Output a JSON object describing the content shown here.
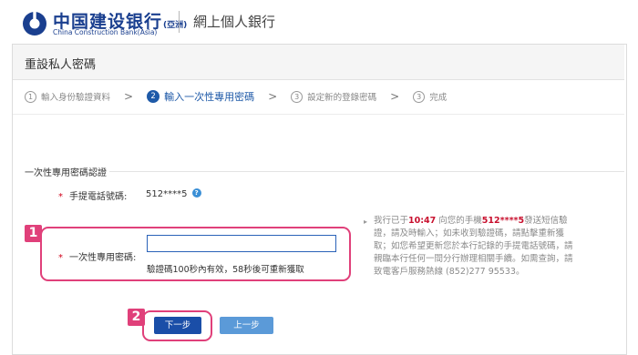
{
  "header": {
    "brand_cn": "中国建设银行",
    "brand_suffix": "(亞洲)",
    "brand_en": "China Construction Bank(Asia)",
    "title": "網上個人銀行",
    "logo_icon": "ccb-logo-icon",
    "brand_color": "#1a3f8f"
  },
  "page": {
    "title": "重設私人密碼"
  },
  "steps": [
    {
      "num": "①",
      "label": "輸入身份驗證資料",
      "active": false
    },
    {
      "num": "2",
      "label": "輸入一次性專用密碼",
      "active": true
    },
    {
      "num": "③",
      "label": "設定新的登錄密碼",
      "active": false
    },
    {
      "num": "③",
      "label": "完成",
      "active": false
    }
  ],
  "step_separator": ">",
  "form": {
    "section_title": "一次性專用密碼認證",
    "required_mark": "*",
    "phone_label": "手提電話號碼:",
    "phone_value": "512****5",
    "help_icon": "question-icon",
    "otp_label": "一次性專用密碼:",
    "otp_value": "",
    "otp_placeholder": "",
    "otp_hint": "驗證碼100秒內有效，58秒後可重新獲取"
  },
  "side_note": {
    "bullet": "▸",
    "prefix": "我行已于",
    "time": "10:47",
    "middle": " 向您的手機",
    "phone": "512****5",
    "suffix": "發送短信驗證，請及時輸入；如未收到驗證碼，請點擊重新獲取；如您希望更新您於本行記錄的手提電話號碼，請親臨本行任何一間分行辦理相關手續。如需查詢，請致電客戶服務熱線 (852)277 95533。"
  },
  "buttons": {
    "next": "下一步",
    "prev": "上一步"
  },
  "highlights": {
    "tag1": "1",
    "tag2": "2"
  },
  "colors": {
    "accent": "#1f5aa8",
    "highlight": "#e0407a",
    "required": "#d0021b",
    "emphasis": "#c8102e"
  }
}
